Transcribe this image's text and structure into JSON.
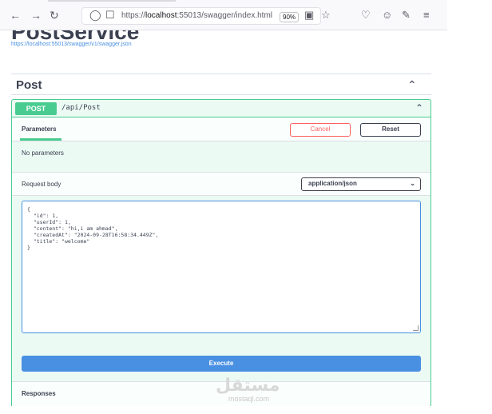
{
  "browser": {
    "back_icon": "arrow-left-icon",
    "forward_icon": "arrow-right-icon",
    "reload_icon": "reload-icon",
    "url_prefix": "https://",
    "url_host": "localhost",
    "url_rest": ":55013/swagger/index.html",
    "zoom": "90%",
    "toolbar_icons": [
      "shield-icon",
      "lock-icon",
      "translate-icon",
      "star-icon",
      "pocket-icon",
      "account-icon",
      "extensions-icon",
      "menu-icon"
    ]
  },
  "service": {
    "title": "PostService",
    "spec_link": "https://localhost:55013/swagger/v1/swagger.json"
  },
  "tag": {
    "name": "Post"
  },
  "operation": {
    "method": "POST",
    "path": "/api/Post",
    "parameters_tab": "Parameters",
    "cancel_label": "Cancel",
    "reset_label": "Reset",
    "no_parameters": "No parameters",
    "request_body_label": "Request body",
    "content_type": "application/json",
    "body_lines": [
      "{",
      "  \"id\": 1,",
      "  \"userId\": 1,",
      "  \"content\": \"hi,i am ahmad\",",
      "  \"createdAt\": \"2024-09-28T16:58:34.449Z\",",
      "  \"title\": \"welcome\"",
      "}"
    ],
    "execute_label": "Execute",
    "responses_label": "Responses"
  },
  "watermark": {
    "logo": "مستقل",
    "text": "mostaql.com"
  },
  "colors": {
    "post_green": "#49cc90",
    "execute_blue": "#4990e2",
    "cancel_red": "#ff6060"
  }
}
